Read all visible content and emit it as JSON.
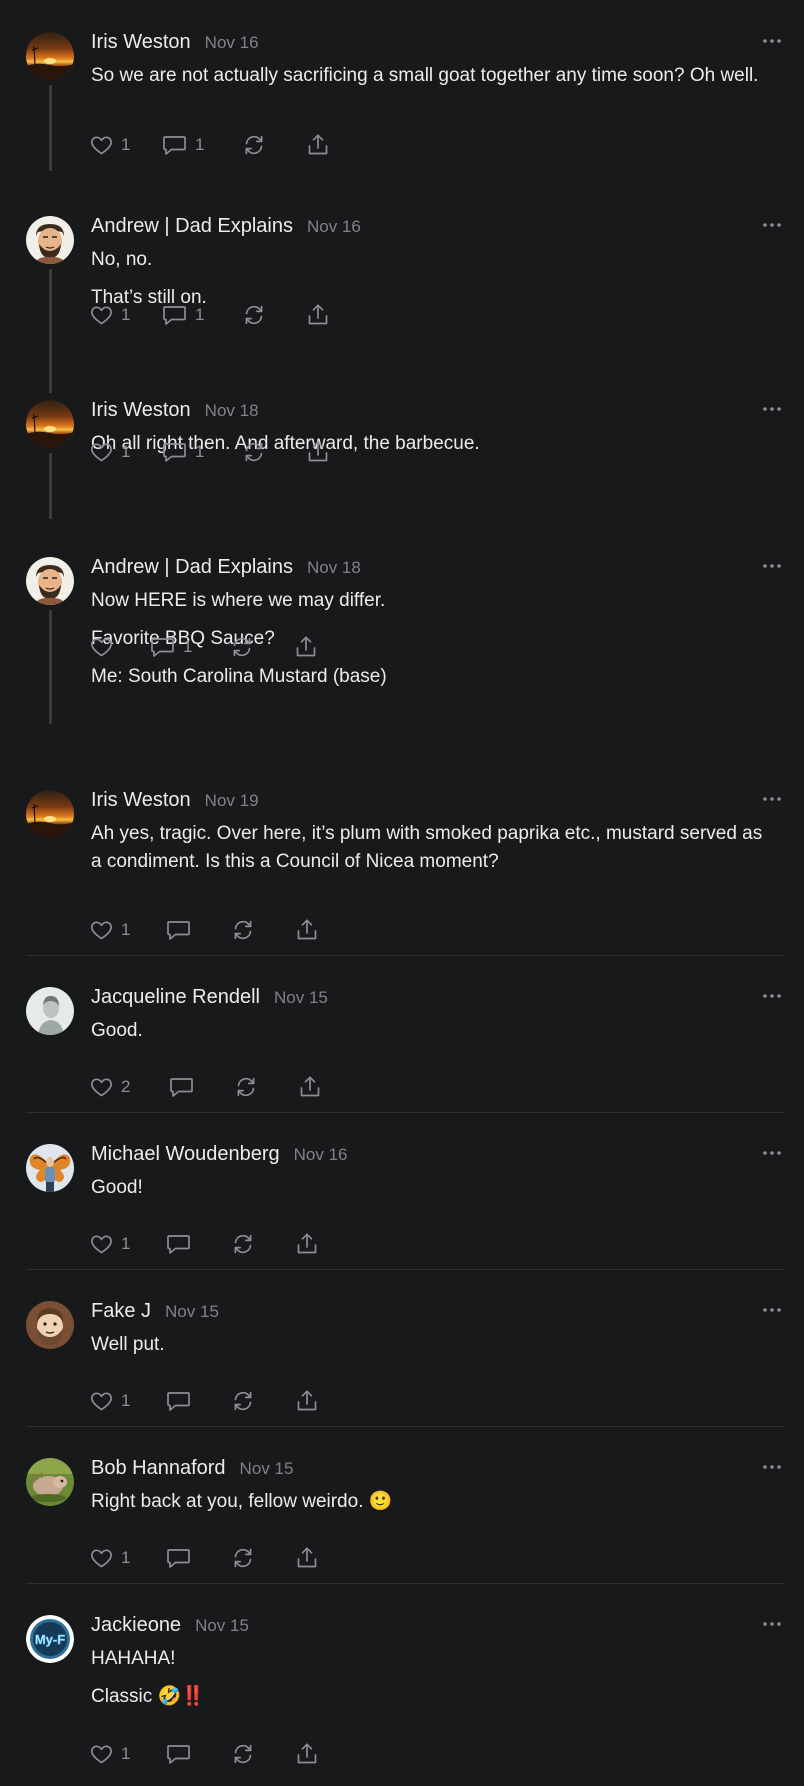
{
  "comments": [
    {
      "author": "Iris Weston",
      "date": "Nov 16",
      "avatar": "sunset",
      "paragraphs": [
        "So we are not actually sacrificing a small goat together any time soon? Oh well."
      ],
      "likes": "1",
      "replies": "1"
    },
    {
      "author": "Andrew | Dad Explains",
      "date": "Nov 16",
      "avatar": "cartoon-man",
      "paragraphs": [
        "No, no.",
        "That’s still on."
      ],
      "likes": "1",
      "replies": "1"
    },
    {
      "author": "Iris Weston",
      "date": "Nov 18",
      "avatar": "sunset",
      "paragraphs": [
        "Oh all right then. And afterward, the barbecue."
      ],
      "likes": "1",
      "replies": "1"
    },
    {
      "author": "Andrew | Dad Explains",
      "date": "Nov 18",
      "avatar": "cartoon-man",
      "paragraphs": [
        "Now HERE is where we may differ.",
        "Favorite BBQ Sauce?",
        "Me: South Carolina Mustard (base)"
      ],
      "likes": "",
      "replies": "1"
    },
    {
      "author": "Iris Weston",
      "date": "Nov 19",
      "avatar": "sunset",
      "paragraphs": [
        "Ah yes, tragic. Over here, it’s plum with smoked paprika etc., mustard served as a condiment. Is this a Council of Nicea moment?"
      ],
      "likes": "1",
      "replies": ""
    },
    {
      "author": "Jacqueline Rendell",
      "date": "Nov 15",
      "avatar": "portrait",
      "paragraphs": [
        "Good."
      ],
      "likes": "2",
      "replies": ""
    },
    {
      "author": "Michael Woudenberg",
      "date": "Nov 16",
      "avatar": "butterfly-person",
      "paragraphs": [
        "Good!"
      ],
      "likes": "1",
      "replies": ""
    },
    {
      "author": "Fake J",
      "date": "Nov 15",
      "avatar": "bearded-cartoon",
      "paragraphs": [
        "Well put."
      ],
      "likes": "1",
      "replies": ""
    },
    {
      "author": "Bob Hannaford",
      "date": "Nov 15",
      "avatar": "animal",
      "paragraphs": [
        "Right back at you, fellow weirdo. 🙂"
      ],
      "likes": "1",
      "replies": ""
    },
    {
      "author": "Jackieone",
      "date": "Nov 15",
      "avatar": "myf-logo",
      "avatar_text": "My-F",
      "paragraphs": [
        "HAHAHA!",
        "Classic 🤣‼️"
      ],
      "likes": "1",
      "replies": ""
    }
  ],
  "icons": {
    "like": "heart-icon",
    "reply": "comment-icon",
    "restack": "restack-icon",
    "share": "share-icon",
    "more": "more-icon"
  }
}
